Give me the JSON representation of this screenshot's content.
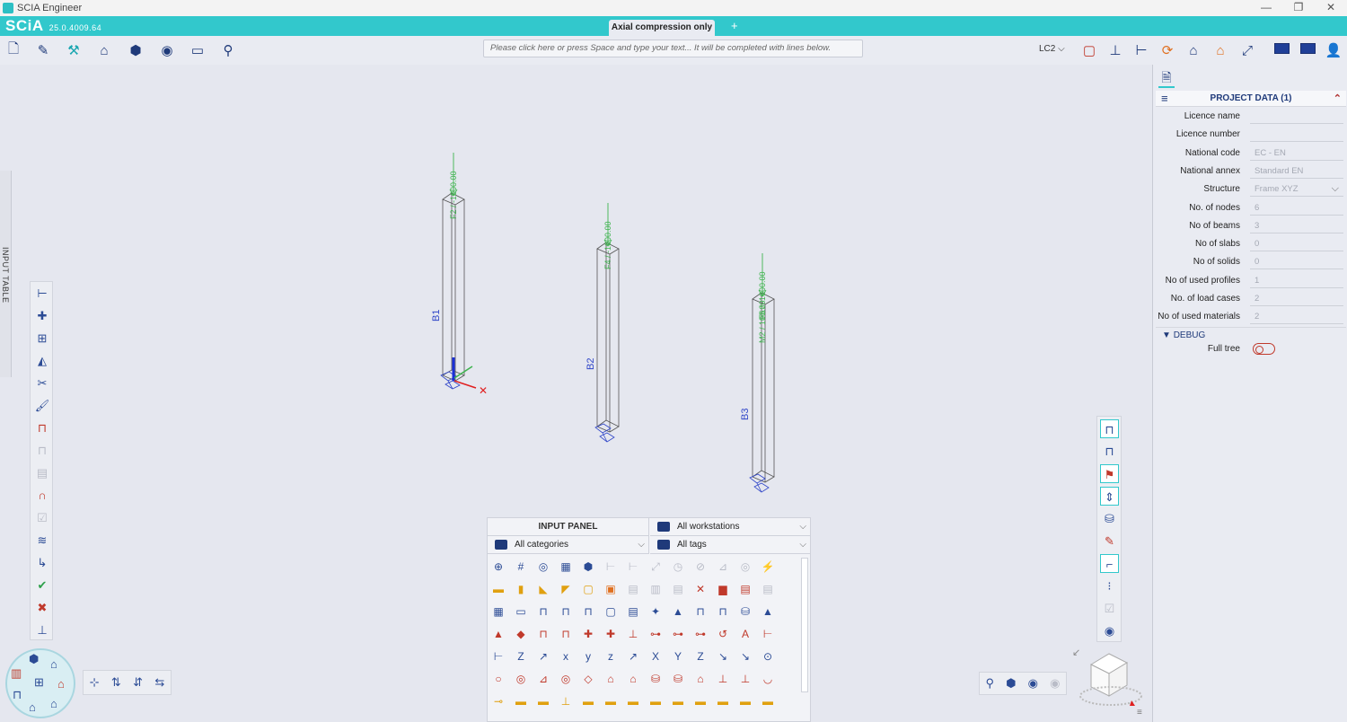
{
  "window": {
    "title": "SCIA Engineer",
    "min": "—",
    "restore": "❐",
    "close": "✕"
  },
  "app": {
    "logo": "SCiA",
    "version": "25.0.4009.64"
  },
  "tabs": {
    "active": "Axial compression only",
    "new_tab": "+"
  },
  "command_line": {
    "placeholder": "Please click here or press Space and type your text... It will be completed with lines below."
  },
  "load_case": {
    "value": "LC2"
  },
  "side_tab": {
    "label": "INPUT TABLE"
  },
  "model": {
    "beams": [
      {
        "name": "B1",
        "load": "F2 / -1000.00"
      },
      {
        "name": "B2",
        "load": "F4 / -1000.00"
      },
      {
        "name": "B3",
        "load": "F6 / -1000.00"
      }
    ],
    "extra_label": "M2 / 100.00"
  },
  "input_panel": {
    "title": "INPUT PANEL",
    "workstations": "All workstations",
    "categories": "All categories",
    "tags": "All tags"
  },
  "project_data": {
    "title": "PROJECT DATA (1)",
    "fields": [
      {
        "label": "Licence name",
        "value": ""
      },
      {
        "label": "Licence number",
        "value": ""
      },
      {
        "label": "National code",
        "value": "EC - EN"
      },
      {
        "label": "National annex",
        "value": "Standard EN"
      },
      {
        "label": "Structure",
        "value": "Frame XYZ"
      },
      {
        "label": "No. of nodes",
        "value": "6"
      },
      {
        "label": "No of beams",
        "value": "3"
      },
      {
        "label": "No of slabs",
        "value": "0"
      },
      {
        "label": "No of solids",
        "value": "0"
      },
      {
        "label": "No of used profiles",
        "value": "1"
      },
      {
        "label": "No. of load cases",
        "value": "2"
      },
      {
        "label": "No of used materials",
        "value": "2"
      }
    ],
    "debug_section": "DEBUG",
    "full_tree_label": "Full tree",
    "full_tree_on": false
  },
  "colors": {
    "accent": "#32c8cc",
    "load": "#3fb34f",
    "beam_label": "#2f45c8",
    "axis_red": "#e02020"
  }
}
